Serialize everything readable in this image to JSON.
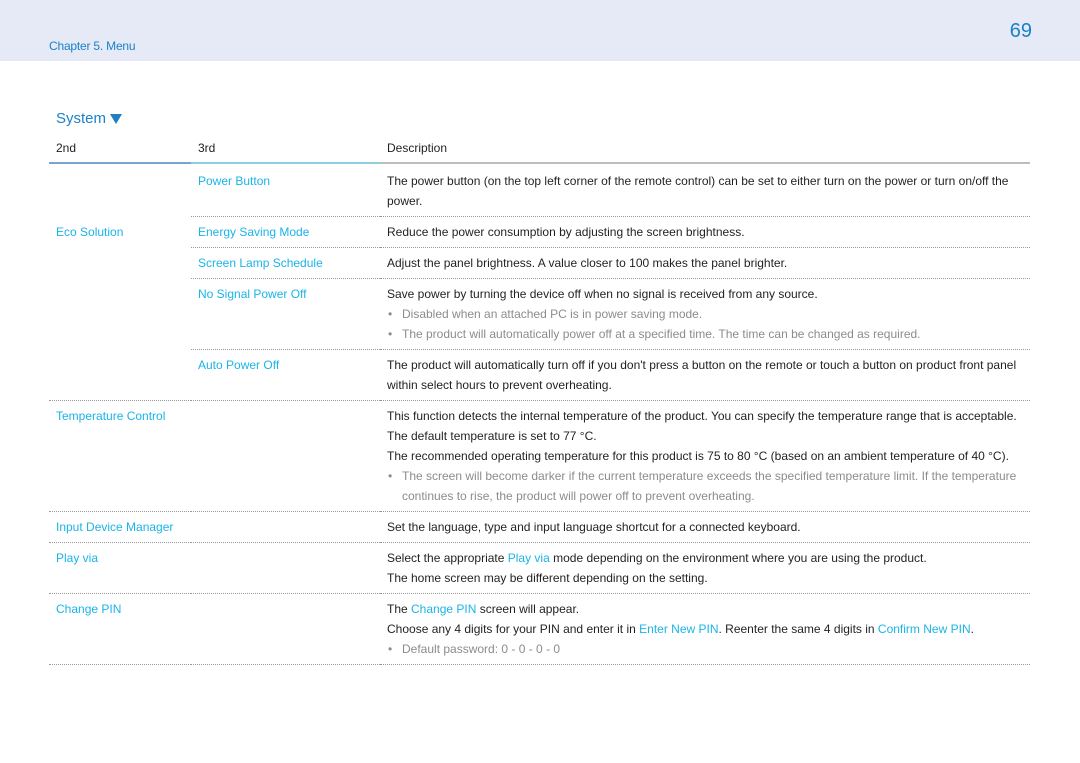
{
  "header": {
    "chapter": "Chapter 5. Menu",
    "page_number": "69"
  },
  "section": {
    "title": "System",
    "icon": "triangle-down-icon"
  },
  "table": {
    "columns": [
      "2nd",
      "3rd",
      "Description"
    ],
    "rows": [
      {
        "second": "",
        "third": "Power Button",
        "lines": [
          "The power button (on the top left corner of the remote control) can be set to either turn on the power or turn on/off the power."
        ],
        "notes": []
      },
      {
        "second": "Eco Solution",
        "third": "Energy Saving Mode",
        "lines": [
          "Reduce the power consumption by adjusting the screen brightness."
        ],
        "notes": []
      },
      {
        "second": "",
        "third": "Screen Lamp Schedule",
        "lines": [
          "Adjust the panel brightness. A value closer to 100 makes the panel brighter."
        ],
        "notes": []
      },
      {
        "second": "",
        "third": "No Signal Power Off",
        "lines": [
          "Save power by turning the device off when no signal is received from any source."
        ],
        "notes": [
          "Disabled when an attached PC is in power saving mode.",
          "The product will automatically power off at a specified time. The time can be changed as required."
        ]
      },
      {
        "second": "",
        "third": "Auto Power Off",
        "lines": [
          "The product will automatically turn off if you don't press a button on the remote or touch a button on product front panel within select hours to prevent overheating."
        ],
        "notes": []
      },
      {
        "second": "Temperature Control",
        "third": "",
        "lines": [
          "This function detects the internal temperature of the product. You can specify the temperature range that is acceptable.",
          "The default temperature is set to 77 °C.",
          "The recommended operating temperature for this product is 75 to 80 °C (based on an ambient temperature of 40 °C)."
        ],
        "notes": [
          "The screen will become darker if the current temperature exceeds the specified temperature limit. If the temperature continues to rise, the product will power off to prevent overheating."
        ]
      },
      {
        "second": "Input Device Manager",
        "third": "",
        "lines": [
          "Set the language, type and input language shortcut for a connected keyboard."
        ],
        "notes": []
      },
      {
        "second": "Play via",
        "third": "",
        "lines": [
          {
            "pre": "Select the appropriate ",
            "link": "Play via",
            "post": " mode depending on the environment where you are using the product."
          },
          "The home screen may be different depending on the setting."
        ],
        "notes": []
      },
      {
        "second": "Change PIN",
        "third": "",
        "lines": [
          {
            "pre": "The ",
            "link": "Change PIN",
            "post": " screen will appear."
          },
          {
            "pre": "Choose any 4 digits for your PIN and enter it in ",
            "link": "Enter New PIN",
            "mid": ". Reenter the same 4 digits in ",
            "link2": "Confirm New PIN",
            "post": "."
          }
        ],
        "notes": [
          "Default password: 0 - 0 - 0 - 0"
        ]
      }
    ]
  }
}
